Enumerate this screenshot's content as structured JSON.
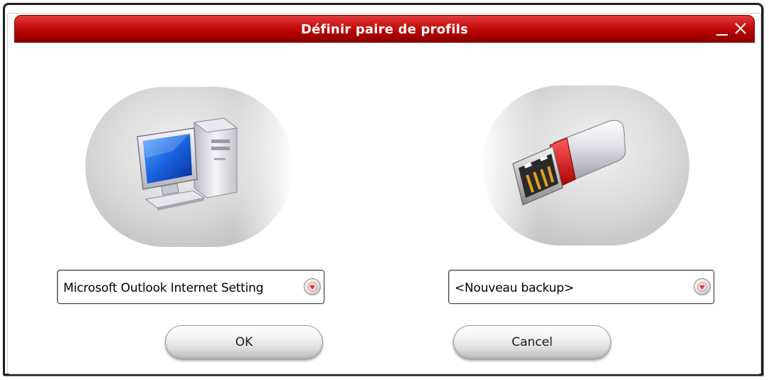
{
  "window": {
    "title": "Définir paire de profils",
    "minimize_icon": "minimize-icon",
    "close_icon": "close-icon",
    "accent_color": "#c60e0e"
  },
  "left_panel": {
    "icon": "computer-icon",
    "profile_value": "Microsoft Outlook Internet Setting"
  },
  "right_panel": {
    "icon": "usb-drive-icon",
    "backup_value": "<Nouveau backup>"
  },
  "buttons": {
    "ok_label": "OK",
    "cancel_label": "Cancel"
  }
}
